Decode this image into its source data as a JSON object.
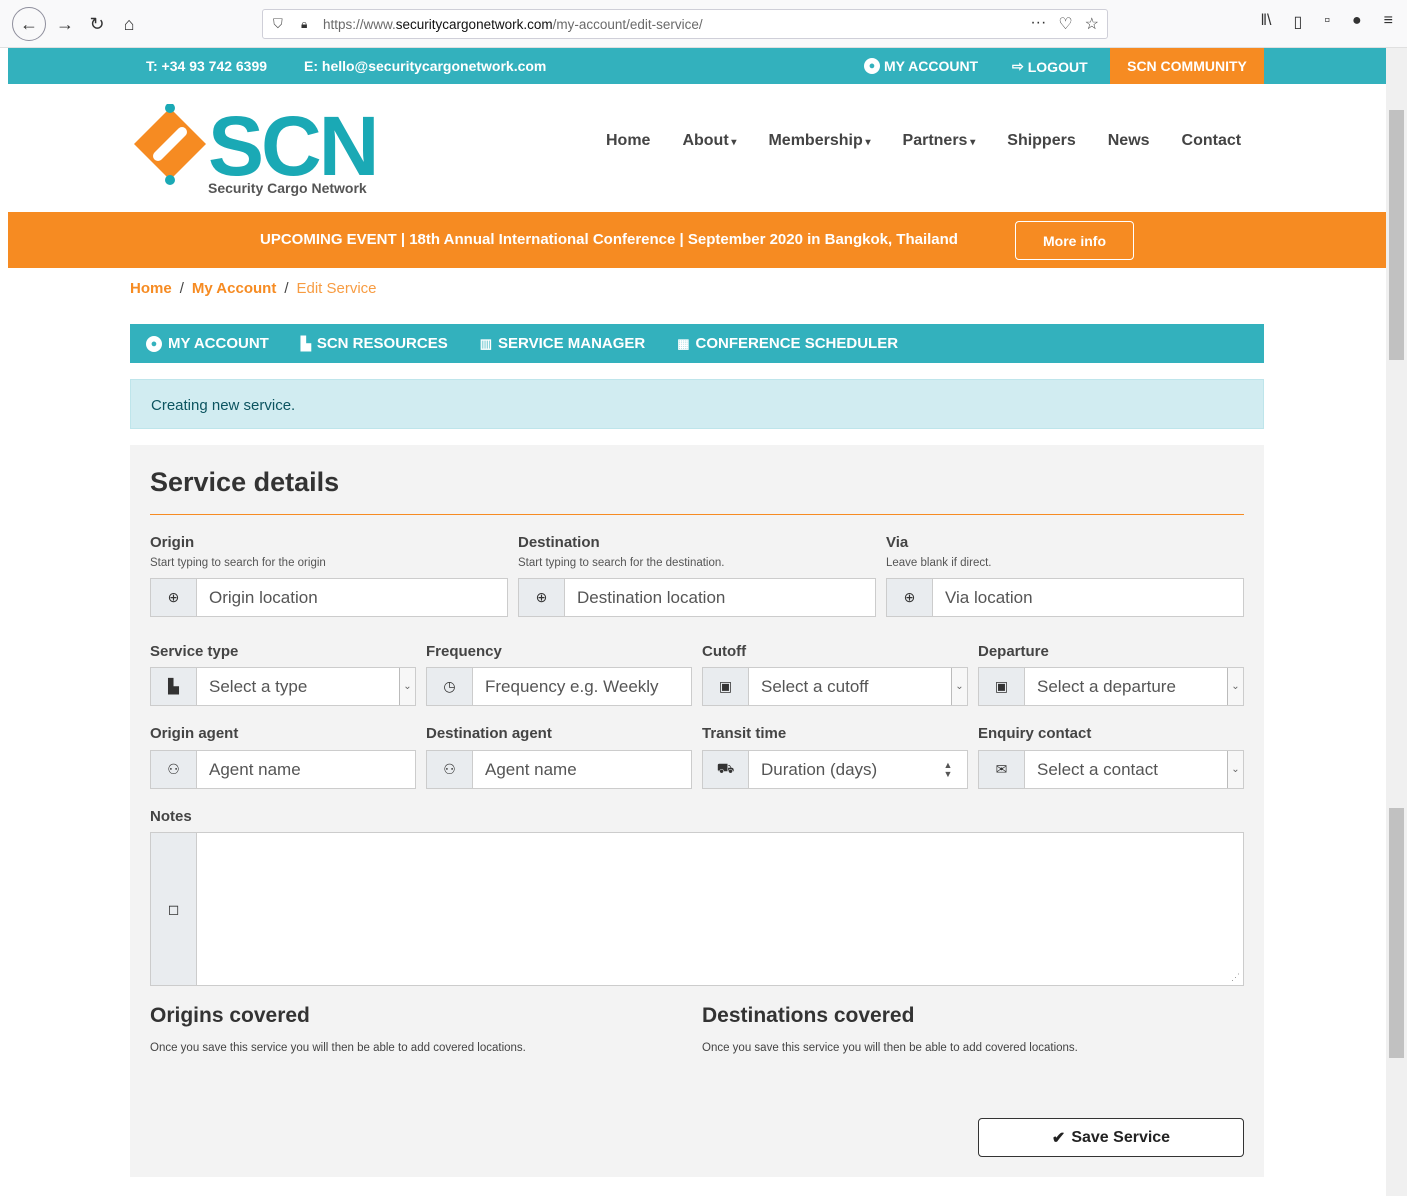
{
  "browser": {
    "url_prefix": "https://www.",
    "url_domain": "securitycargonetwork.com",
    "url_path": "/my-account/edit-service/"
  },
  "topbar": {
    "phone": "T: +34 93 742 6399",
    "email": "E: hello@securitycargonetwork.com",
    "my_account": "MY ACCOUNT",
    "logout": "LOGOUT",
    "community": "SCN COMMUNITY"
  },
  "logo": {
    "mark": "SCN",
    "tagline": "Security Cargo Network"
  },
  "mainnav": [
    "Home",
    "About",
    "Membership",
    "Partners",
    "Shippers",
    "News",
    "Contact"
  ],
  "event": {
    "text": "UPCOMING EVENT | 18th Annual International Conference | September 2020 in Bangkok, Thailand",
    "button": "More info"
  },
  "breadcrumb": {
    "home": "Home",
    "sep": "/",
    "account": "My Account",
    "current": "Edit Service"
  },
  "accnav": {
    "my_account": "MY ACCOUNT",
    "resources": "SCN RESOURCES",
    "service_manager": "SERVICE MANAGER",
    "scheduler": "CONFERENCE SCHEDULER"
  },
  "alert": "Creating new service.",
  "form": {
    "title": "Service details",
    "origin": {
      "label": "Origin",
      "hint": "Start typing to search for the origin",
      "placeholder": "Origin location"
    },
    "destination": {
      "label": "Destination",
      "hint": "Start typing to search for the destination.",
      "placeholder": "Destination location"
    },
    "via": {
      "label": "Via",
      "hint": "Leave blank if direct.",
      "placeholder": "Via location"
    },
    "service_type": {
      "label": "Service type",
      "value": "Select a type"
    },
    "frequency": {
      "label": "Frequency",
      "placeholder": "Frequency e.g. Weekly"
    },
    "cutoff": {
      "label": "Cutoff",
      "value": "Select a cutoff"
    },
    "departure": {
      "label": "Departure",
      "value": "Select a departure"
    },
    "origin_agent": {
      "label": "Origin agent",
      "placeholder": "Agent name"
    },
    "destination_agent": {
      "label": "Destination agent",
      "placeholder": "Agent name"
    },
    "transit_time": {
      "label": "Transit time",
      "placeholder": "Duration (days)"
    },
    "enquiry_contact": {
      "label": "Enquiry contact",
      "value": "Select a contact"
    },
    "notes": {
      "label": "Notes"
    },
    "origins_covered": {
      "title": "Origins covered",
      "text": "Once you save this service you will then be able to add covered locations."
    },
    "destinations_covered": {
      "title": "Destinations covered",
      "text": "Once you save this service you will then be able to add covered locations."
    },
    "save": "Save Service"
  }
}
